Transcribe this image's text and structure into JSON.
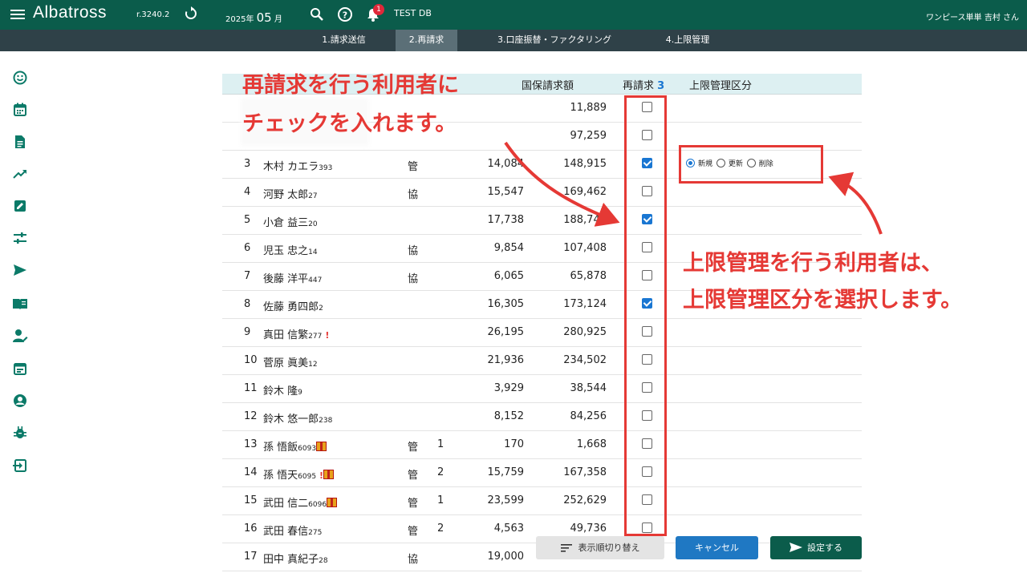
{
  "header": {
    "brand": "Albatross",
    "version": "r.3240.2",
    "year": "2025年",
    "month": "05",
    "month_suffix": "月",
    "notification_count": "1",
    "db_name": "TEST DB",
    "user": "ワンピース単単 吉村 さん"
  },
  "tabs": [
    "1.請求送信",
    "2.再請求",
    "3.口座振替・ファクタリング",
    "4.上限管理"
  ],
  "active_tab": 1,
  "sidebar": {
    "icons": [
      "smile-icon",
      "calendar-icon",
      "document-icon",
      "trending-up-icon",
      "edit-icon",
      "sliders-icon",
      "send-icon",
      "book-icon",
      "user-edit-icon",
      "event-icon",
      "account-circle-icon",
      "bug-icon",
      "logout-icon"
    ]
  },
  "table": {
    "headers": {
      "amount": "国保請求額",
      "rebill": "再請求",
      "rebill_count": "3",
      "limit": "上限管理区分"
    },
    "rows": [
      {
        "no": "",
        "name": "",
        "code": "",
        "type": "",
        "count": "",
        "v1": "",
        "v2": "11,889",
        "checked": false
      },
      {
        "no": "",
        "name": "",
        "code": "",
        "type": "",
        "count": "",
        "v1": "",
        "v2": "97,259",
        "checked": false
      },
      {
        "no": "3",
        "name": "木村 カエラ",
        "code": "393",
        "type": "管",
        "count": "",
        "v1": "14,084",
        "v2": "148,915",
        "checked": true
      },
      {
        "no": "4",
        "name": "河野 太郎",
        "code": "27",
        "type": "協",
        "count": "",
        "v1": "15,547",
        "v2": "169,462",
        "checked": false
      },
      {
        "no": "5",
        "name": "小倉 益三",
        "code": "20",
        "type": "",
        "count": "",
        "v1": "17,738",
        "v2": "188,741",
        "checked": true
      },
      {
        "no": "6",
        "name": "児玉 忠之",
        "code": "14",
        "type": "協",
        "count": "",
        "v1": "9,854",
        "v2": "107,408",
        "checked": false
      },
      {
        "no": "7",
        "name": "後藤 洋平",
        "code": "447",
        "type": "協",
        "count": "",
        "v1": "6,065",
        "v2": "65,878",
        "checked": false
      },
      {
        "no": "8",
        "name": "佐藤 勇四郎",
        "code": "2",
        "type": "",
        "count": "",
        "v1": "16,305",
        "v2": "173,124",
        "checked": true
      },
      {
        "no": "9",
        "name": "真田 信繁",
        "code": "277",
        "type": "",
        "count": "",
        "v1": "26,195",
        "v2": "280,925",
        "checked": false,
        "warn": "!"
      },
      {
        "no": "10",
        "name": "菅原 眞美",
        "code": "12",
        "type": "",
        "count": "",
        "v1": "21,936",
        "v2": "234,502",
        "checked": false
      },
      {
        "no": "11",
        "name": "鈴木 隆",
        "code": "9",
        "type": "",
        "count": "",
        "v1": "3,929",
        "v2": "38,544",
        "checked": false
      },
      {
        "no": "12",
        "name": "鈴木 悠一郎",
        "code": "238",
        "type": "",
        "count": "",
        "v1": "8,152",
        "v2": "84,256",
        "checked": false
      },
      {
        "no": "13",
        "name": "孫 悟飯",
        "code": "6093",
        "type": "管",
        "count": "1",
        "v1": "170",
        "v2": "1,668",
        "checked": false,
        "gift": true
      },
      {
        "no": "14",
        "name": "孫 悟天",
        "code": "6095",
        "type": "管",
        "count": "2",
        "v1": "15,759",
        "v2": "167,358",
        "checked": false,
        "gift": true,
        "warn": "!"
      },
      {
        "no": "15",
        "name": "武田 信二",
        "code": "6096",
        "type": "管",
        "count": "1",
        "v1": "23,599",
        "v2": "252,629",
        "checked": false,
        "gift": true
      },
      {
        "no": "16",
        "name": "武田 春信",
        "code": "275",
        "type": "管",
        "count": "2",
        "v1": "4,563",
        "v2": "49,736",
        "checked": false
      },
      {
        "no": "17",
        "name": "田中 真紀子",
        "code": "28",
        "type": "協",
        "count": "",
        "v1": "19,000",
        "v2": "",
        "checked": false
      }
    ]
  },
  "limit_options": {
    "labels": [
      "新規",
      "更新",
      "削除"
    ],
    "selected": 0
  },
  "annotations": {
    "left_line1": "再請求を行う利用者に",
    "left_line2": "チェックを入れます。",
    "right_line1": "上限管理を行う利用者は、",
    "right_line2": "上限管理区分を選択します。"
  },
  "buttons": {
    "toggle": "表示順切り替え",
    "cancel": "キャンセル",
    "set": "設定する"
  },
  "colors": {
    "header_bg": "#0b5c4b",
    "tab_bg": "#2f4148",
    "accent": "#1976d2",
    "annotation": "#e53935"
  }
}
